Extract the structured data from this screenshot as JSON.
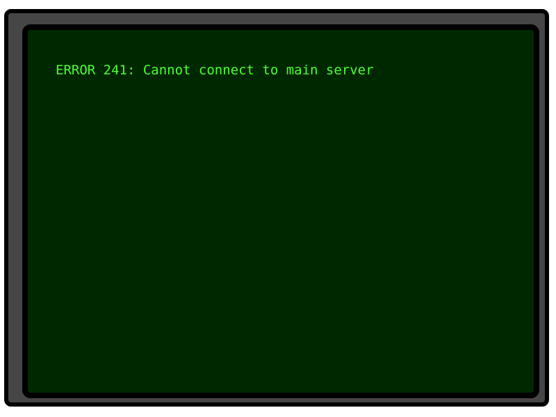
{
  "terminal": {
    "lines": [
      "ERROR 241: Cannot connect to main server"
    ]
  },
  "colors": {
    "screen_background": "#002800",
    "terminal_text": "#4cff33",
    "bezel": "#464646",
    "outline": "#000000"
  }
}
